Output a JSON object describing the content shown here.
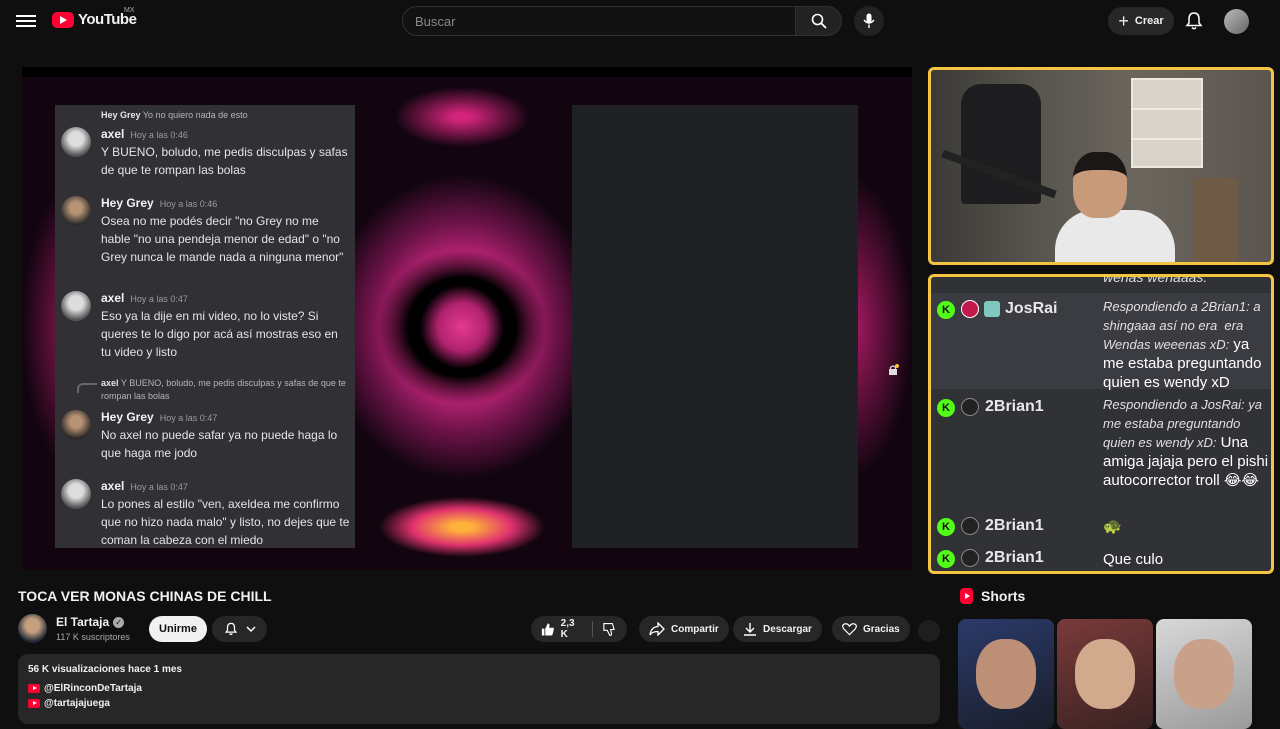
{
  "header": {
    "logo_text": "YouTube",
    "country_code": "MX",
    "search_placeholder": "Buscar",
    "create_label": "Crear"
  },
  "video_content": {
    "reply_top": {
      "user": "Hey Grey",
      "text": "Yo no quiero nada de esto"
    },
    "messages": [
      {
        "user": "axel",
        "time": "Hoy a las 0:46",
        "body": "Y BUENO, boludo, me pedis disculpas y safas de que te rompan las bolas"
      },
      {
        "user": "Hey Grey",
        "time": "Hoy a las 0:46",
        "body": "Osea no me podés decir \"no Grey no me hable \"no una pendeja menor de edad\" o \"no Grey nunca le mande nada a ninguna menor\""
      },
      {
        "user": "axel",
        "time": "Hoy a las 0:47",
        "body": "Eso ya la dije en mi video, no lo viste? Si queres te lo digo por acá así mostras eso en tu video y listo"
      },
      {
        "user": "Hey Grey",
        "time": "Hoy a las 0:47",
        "body": "No axel no puede safar ya no puede haga lo que haga me jodo"
      },
      {
        "user": "axel",
        "time": "Hoy a las 0:47",
        "body": "Lo pones al estilo \"ven, axeldea me confirmo que no hizo nada malo\" y listo, no dejes que te coman la cabeza con el miedo"
      }
    ],
    "reply_mid": {
      "user": "axel",
      "text": "Y BUENO, boludo, me pedis disculpas y safas de que te rompan las bolas"
    }
  },
  "stream_chat": {
    "cut_top": "wenas wenaaas:",
    "rows": [
      {
        "user": "JosRai",
        "reply": "Respondiendo a 2Brian1: a shingaaa así no era 󠀠󠀠 era Wendas weeenas xD:",
        "text": "ya me estaba preguntando quien es wendy xD"
      },
      {
        "user": "2Brian1",
        "reply": "Respondiendo a JosRai: ya me estaba preguntando quien es wendy xD:",
        "text": "Una amiga jajaja pero el pishi autocorrector troll 😂😂"
      },
      {
        "user": "2Brian1",
        "reply": "",
        "text": "🐢"
      },
      {
        "user": "2Brian1",
        "reply": "",
        "text": "Que culo"
      }
    ]
  },
  "video_info": {
    "title": "TOCA VER MONAS CHINAS DE CHILL",
    "channel_name": "El Tartaja",
    "subscribers": "117 K suscriptores",
    "join_label": "Unirme",
    "likes": "2,3 K",
    "share_label": "Compartir",
    "download_label": "Descargar",
    "thanks_label": "Gracias",
    "views_date": "56 K visualizaciones  hace 1 mes",
    "links": [
      "@ElRinconDeTartaja",
      "@tartajajuega"
    ]
  },
  "shorts": {
    "title": "Shorts"
  }
}
